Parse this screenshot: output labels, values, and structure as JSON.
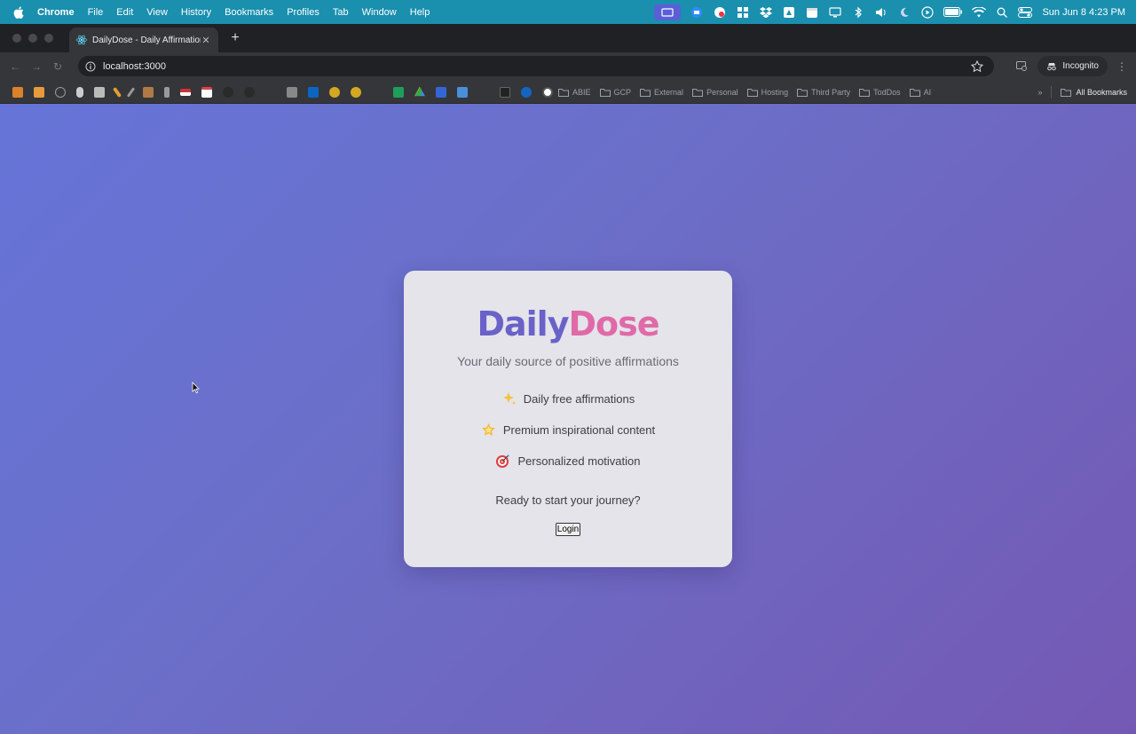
{
  "menubar": {
    "app_name": "Chrome",
    "items": [
      "File",
      "Edit",
      "View",
      "History",
      "Bookmarks",
      "Profiles",
      "Tab",
      "Window",
      "Help"
    ],
    "clock": "Sun Jun 8  4:23 PM"
  },
  "browser": {
    "tab": {
      "title": "DailyDose - Daily Affirmations"
    },
    "url": "localhost:3000",
    "profile_label": "Incognito",
    "bookmark_folders": [
      "ABIE",
      "GCP",
      "External",
      "Personal",
      "Hosting",
      "Third Party",
      "TodDos",
      "AI"
    ],
    "all_bookmarks_label": "All Bookmarks"
  },
  "card": {
    "brand_part1": "Daily",
    "brand_part2": "Dose",
    "tagline": "Your daily source of positive affirmations",
    "features": [
      {
        "icon": "sparkles-icon",
        "label": "Daily free affirmations"
      },
      {
        "icon": "star-icon",
        "label": "Premium inspirational content"
      },
      {
        "icon": "target-icon",
        "label": "Personalized motivation"
      }
    ],
    "prompt": "Ready to start your journey?",
    "login_label": "Login"
  },
  "colors": {
    "menubar": "#1a8fae",
    "brand_daily": "#6a62c8",
    "brand_dose": "#e06aa8",
    "background_start": "#6674d8",
    "background_end": "#7459b4"
  }
}
